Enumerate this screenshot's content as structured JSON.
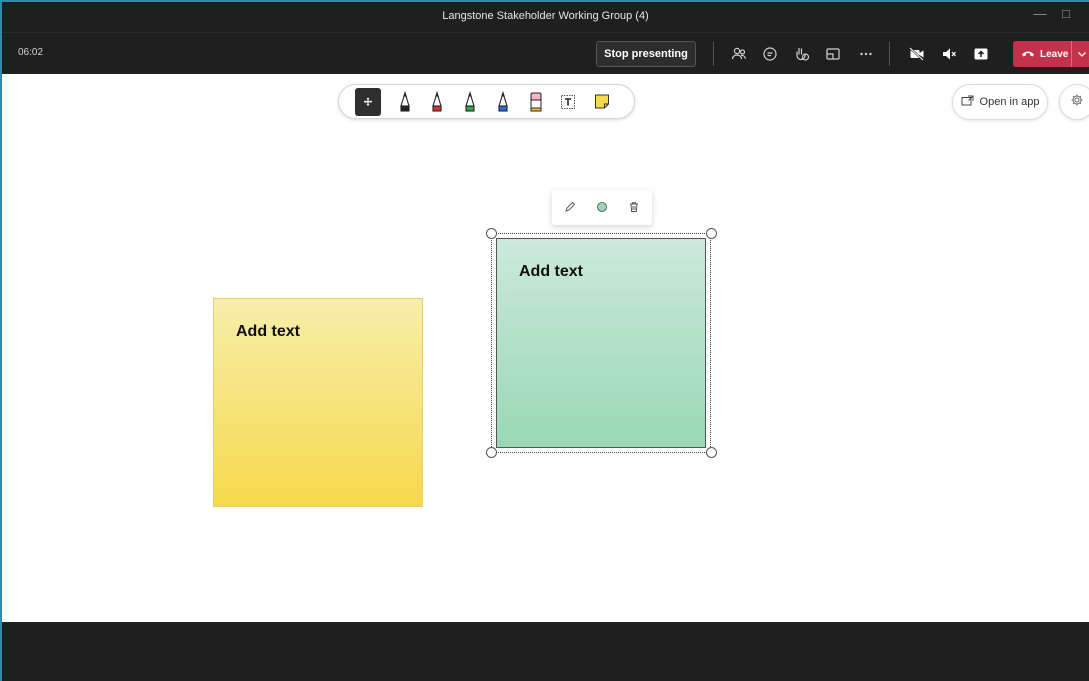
{
  "window": {
    "title": "Langstone Stakeholder Working Group (4)"
  },
  "meeting_bar": {
    "timer": "06:02",
    "stop_presenting_label": "Stop presenting",
    "leave_label": "Leave",
    "icons": [
      "people-icon",
      "chat-icon",
      "reactions-icon",
      "rooms-icon",
      "more-icon",
      "camera-off-icon",
      "mute-icon",
      "share-icon"
    ]
  },
  "whiteboard": {
    "toolbar_tools": [
      "select-icon",
      "pen-black-icon",
      "pen-red-icon",
      "pen-green-icon",
      "pen-blue-icon",
      "eraser-icon",
      "text-icon",
      "sticky-note-icon"
    ],
    "open_in_app_label": "Open in app",
    "notes": [
      {
        "text": "Add text",
        "color": "#f6d94c"
      },
      {
        "text": "Add text",
        "color": "#99d8b4"
      }
    ],
    "note_menu_icons": [
      "edit-icon",
      "color-icon",
      "delete-icon"
    ]
  },
  "colors": {
    "leave": "#c4314b",
    "accent_border": "#2a8fa8",
    "bar": "#1f1f1f"
  }
}
